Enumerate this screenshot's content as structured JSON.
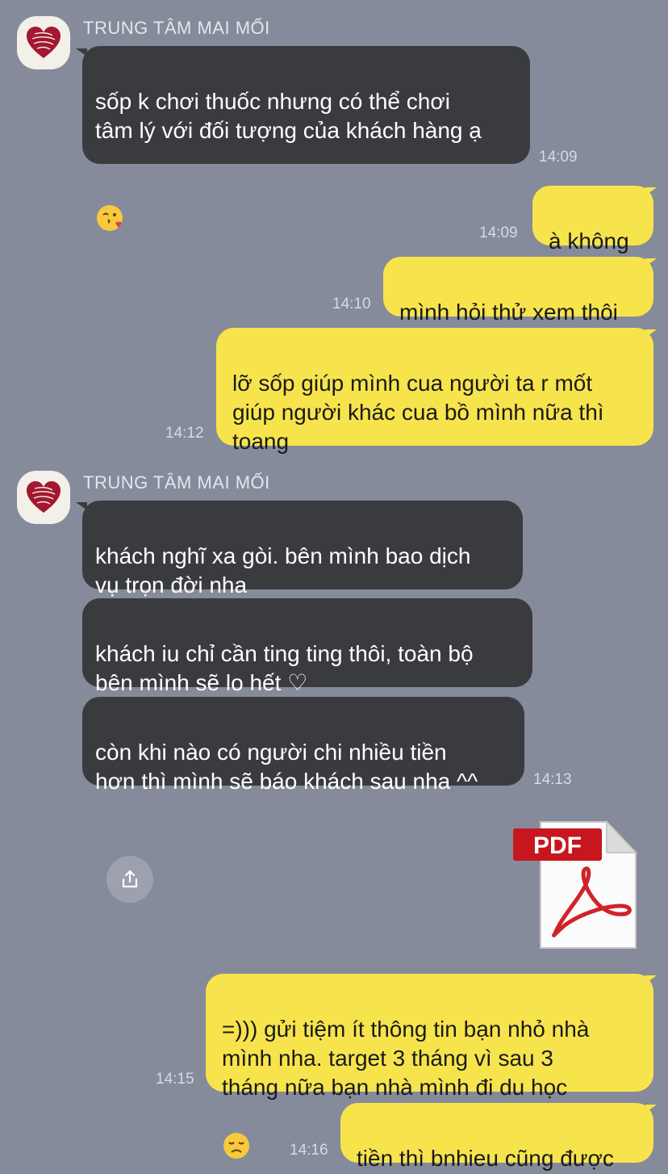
{
  "group1": {
    "sender_name": "TRUNG TÂM MAI MỐI",
    "message": "sốp k chơi thuốc nhưng có thể chơi\ntâm lý với đối tượng của khách hàng ạ",
    "time": "14:09"
  },
  "out1": {
    "message": "à không",
    "time": "14:09"
  },
  "out2": {
    "message": "mình hỏi thử xem thôi",
    "time": "14:10"
  },
  "out3": {
    "message": "lỡ sốp giúp mình cua người ta r mốt\ngiúp người khác cua bồ mình nữa thì\ntoang",
    "time": "14:12"
  },
  "group2": {
    "sender_name": "TRUNG TÂM MAI MỐI",
    "msg1": "khách nghĩ xa gòi. bên mình bao dịch\nvụ trọn đời nha",
    "msg2": "khách iu chỉ cần ting ting thôi, toàn bộ\nbên mình sẽ lo hết ♡",
    "msg3": "còn khi nào có người chi nhiều tiền\nhơn thì mình sẽ báo khách sau nha ^^",
    "time": "14:13"
  },
  "file": {
    "badge": "PDF",
    "icon": "pdf-file-icon",
    "share_icon": "share-icon"
  },
  "out4": {
    "message": "=))) gửi tiệm ít thông tin bạn nhỏ nhà\nmình nha. target 3 tháng vì sau 3\ntháng nữa bạn nhà mình đi du học",
    "time": "14:15"
  },
  "out5": {
    "message": "tiền thì bnhieu cũng được",
    "time": "14:16"
  },
  "colors": {
    "background": "#858b9a",
    "incoming_bubble": "#3a3b3f",
    "outgoing_bubble": "#f7e44c"
  }
}
